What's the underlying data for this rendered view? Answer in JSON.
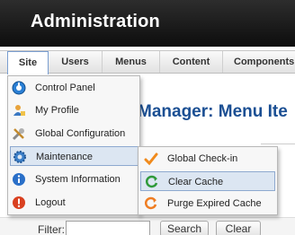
{
  "header": {
    "title": "Administration"
  },
  "menubar": {
    "items": [
      {
        "label": "Site",
        "active": true
      },
      {
        "label": "Users"
      },
      {
        "label": "Menus"
      },
      {
        "label": "Content"
      },
      {
        "label": "Components"
      }
    ]
  },
  "site_menu": {
    "items": [
      {
        "label": "Control Panel",
        "icon": "control-panel-icon"
      },
      {
        "label": "My Profile",
        "icon": "user-profile-icon"
      },
      {
        "label": "Global Configuration",
        "icon": "tools-icon"
      },
      {
        "label": "Maintenance",
        "icon": "gear-icon",
        "highlighted": true
      },
      {
        "label": "System Information",
        "icon": "info-icon"
      },
      {
        "label": "Logout",
        "icon": "logout-icon"
      }
    ]
  },
  "maintenance_submenu": {
    "items": [
      {
        "label": "Global Check-in",
        "icon": "checkmark-icon"
      },
      {
        "label": "Clear Cache",
        "icon": "refresh-icon",
        "highlighted": true
      },
      {
        "label": "Purge Expired Cache",
        "icon": "purge-icon"
      }
    ]
  },
  "main": {
    "page_title": "Manager: Menu Ite",
    "filter_label": "Filter:",
    "filter_value": "",
    "search_button": "Search",
    "clear_button": "Clear"
  }
}
